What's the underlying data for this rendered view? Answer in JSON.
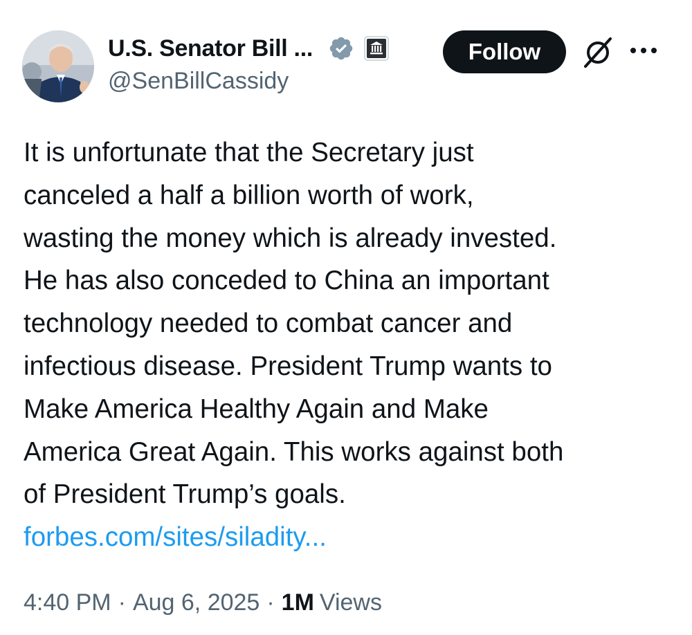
{
  "author": {
    "display_name": "U.S. Senator Bill ...",
    "handle": "@SenBillCassidy",
    "avatar": "avatar-photo",
    "verified_badge": "verified-checkmark-icon",
    "affiliation_badge": "government-building-icon"
  },
  "actions": {
    "follow_label": "Follow",
    "grok_icon": "grok-icon",
    "more_icon": "more-options-icon"
  },
  "tweet": {
    "lines": [
      "It is unfortunate that the Secretary just",
      "canceled a half a billion worth of work,",
      "wasting the money which is already invested.",
      "He has also conceded to China an important",
      "technology needed to combat cancer and",
      "infectious disease. President Trump wants to",
      "Make America Healthy Again and Make",
      "America Great Again. This works against both",
      "of President Trump’s goals."
    ],
    "link": "forbes.com/sites/siladity..."
  },
  "meta": {
    "time": "4:40 PM",
    "separator": "·",
    "date": "Aug 6, 2025",
    "views_count": "1M",
    "views_label": "Views"
  },
  "colors": {
    "text": "#0f1419",
    "secondary": "#536471",
    "link": "#1d9bf0",
    "verified_badge": "#829aab",
    "follow_bg": "#0f1419"
  }
}
